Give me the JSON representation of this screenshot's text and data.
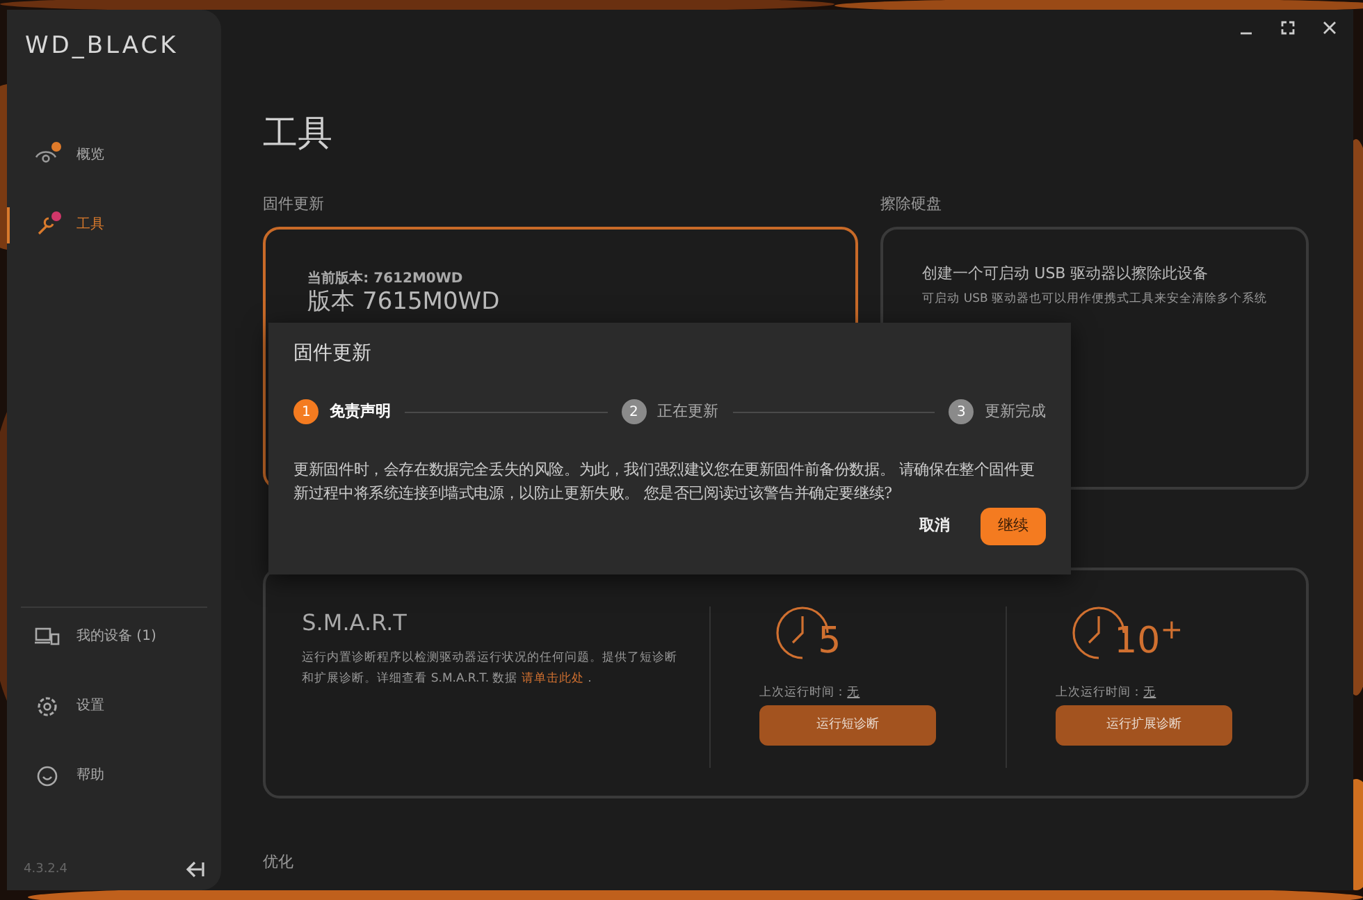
{
  "logo": "WD_BLACK",
  "window_controls": [
    {
      "kind": "minimize"
    },
    {
      "kind": "maximize"
    },
    {
      "kind": "close"
    }
  ],
  "sidebar": {
    "items": [
      {
        "label": "概览",
        "kind": "eye",
        "selected": false,
        "color": "#e07b2a"
      },
      {
        "label": "工具",
        "kind": "wrench",
        "selected": true,
        "color": "#d2376a"
      }
    ],
    "bottom_items": [
      {
        "label": "我的设备 (1)",
        "kind": "devices"
      },
      {
        "label": "设置",
        "kind": "gear"
      },
      {
        "label": "帮助",
        "kind": "smile"
      }
    ],
    "version": "4.3.2.4"
  },
  "page_title": "工具",
  "firmware": {
    "section": "固件更新",
    "current": "当前版本: 7612M0WD",
    "new_version": "版本 7615M0WD"
  },
  "erase": {
    "section": "擦除硬盘",
    "title": "创建一个可启动 USB 驱动器以擦除此设备",
    "text": "可启动 USB 驱动器也可以用作便携式工具来安全清除多个系统"
  },
  "smart": {
    "title": "S.M.A.R.T",
    "text": "运行内置诊断程序以检测驱动器运行状况的任何问题。提供了短诊断和扩展诊断。详细查看 S.M.A.R.T. 数据",
    "link": "请单击此处",
    "suffix": ".",
    "tests": [
      {
        "minutes": "5",
        "last_run_label": "上次运行时间：",
        "last_run": "无",
        "button": "运行短诊断"
      },
      {
        "minutes": "10$^{+}$",
        "last_run_label": "上次运行时间：",
        "last_run": "无",
        "button": "运行扩展诊断"
      }
    ]
  },
  "next_section": "优化",
  "dialog": {
    "title": "固件更新",
    "steps": [
      {
        "number": "1",
        "label": "免责声明",
        "selected": true
      },
      {
        "number": "2",
        "label": "正在更新",
        "selected": false
      },
      {
        "number": "3",
        "label": "更新完成",
        "selected": false
      }
    ],
    "message": "更新固件时，会存在数据完全丢失的风险。为此，我们强烈建议您在更新固件前备份数据。 请确保在整个固件更新过程中将系统连接到墙式电源，以防止更新失败。 您是否已阅读过该警告并确定要继续?",
    "cancel": "取消",
    "confirm": "继续"
  }
}
